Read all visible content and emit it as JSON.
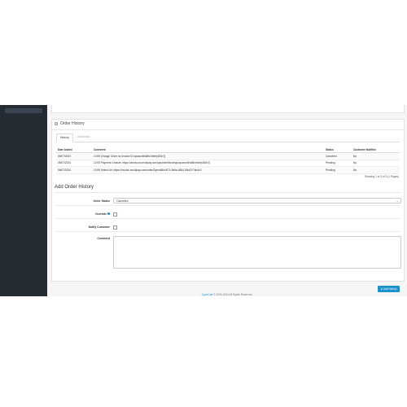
{
  "order_history": {
    "title": "Order History",
    "tabs": [
      {
        "label": "History"
      },
      {
        "label": "Additional"
      }
    ],
    "table": {
      "headers": [
        "Date Added",
        "Comment",
        "Status",
        "Customer Notified"
      ],
      "rows": [
        [
          "06/07/2024",
          "10:59 Change Order for Invoice ID:opasxv6Nb8b4mbrfyi3Nn7]",
          "Canceled",
          "No"
        ],
        [
          "06/07/2024",
          "10:59 Payment Creacte: https://checkout.xendipay.com/payment/bindings/opasxv6Nb8b4mbrfyi3Nn7]",
          "Pending",
          "No"
        ],
        [
          "06/07/2024",
          "10:59 Select Url: https://invoice.xendipay.com/order/Dynm66k4KT4-9b6a-4884-9f4d2Y7ab4c2",
          "Pending",
          "No"
        ]
      ]
    },
    "showing_text": "Showing 1 to 3 of 3 (1 Pages)"
  },
  "add_history": {
    "title": "Add Order History",
    "order_status_label": "Order Status",
    "order_status_value": "Canceled",
    "override_label": "Override",
    "notify_label": "Notify Customer",
    "comment_label": "Comment",
    "button_label": "⊕ Add History"
  },
  "footer": {
    "brand": "OpenCart",
    "text": " © 2009-2024 All Rights Reserved."
  },
  "colors": {
    "sidebar": "#252b33",
    "primary": "#1e91cf"
  }
}
